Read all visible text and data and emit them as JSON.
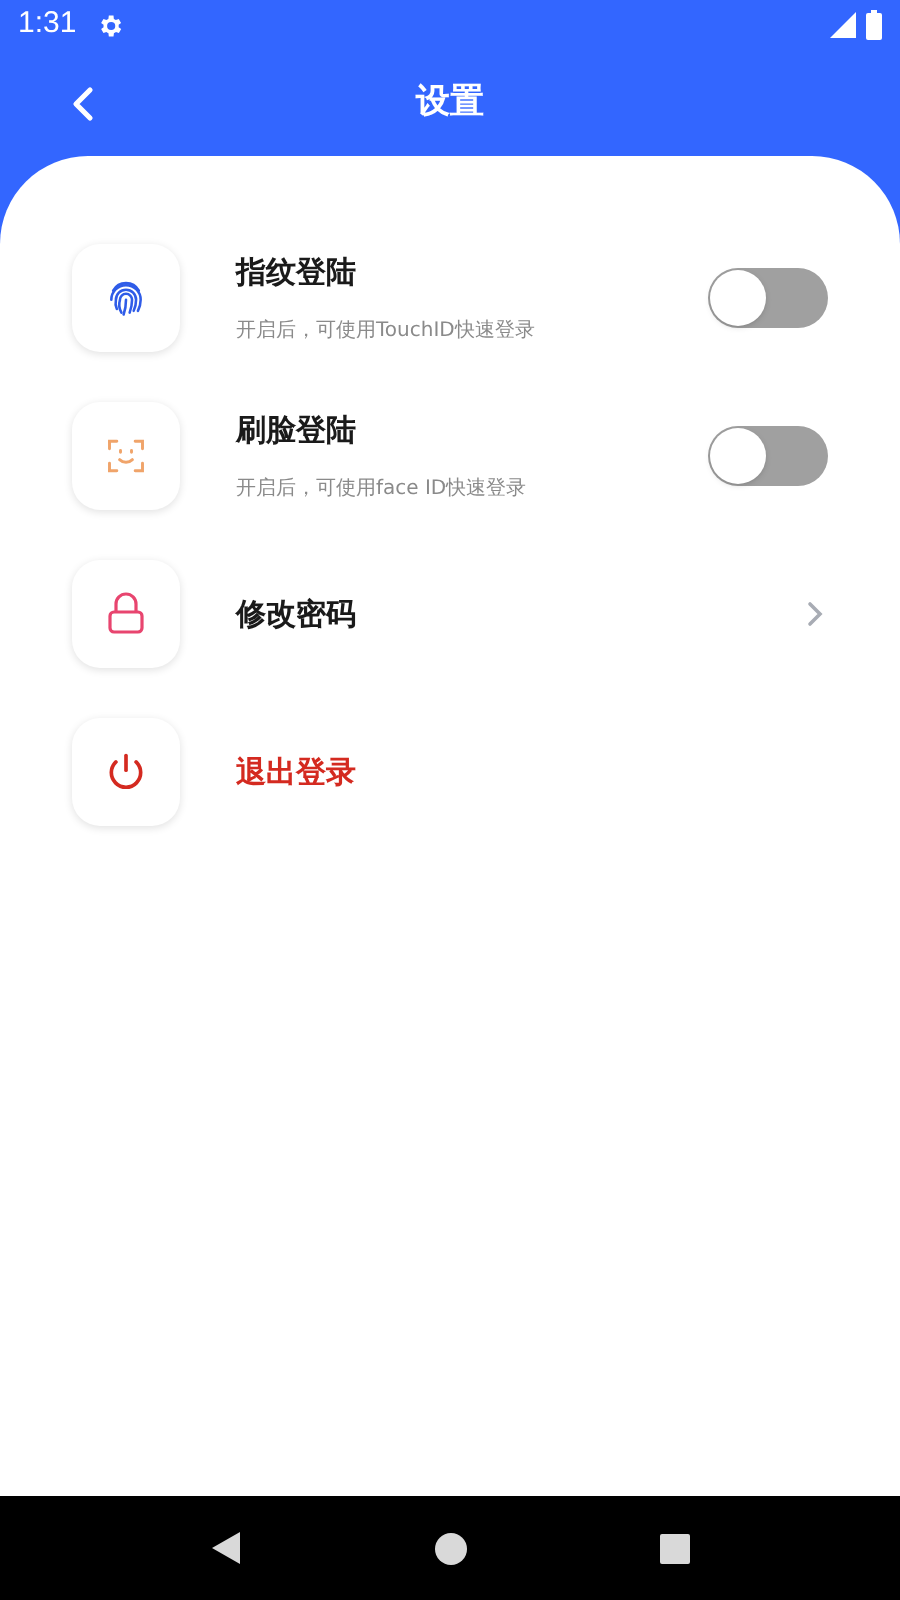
{
  "status_bar": {
    "time": "1:31"
  },
  "header": {
    "title": "设置"
  },
  "items": [
    {
      "kind": "toggle",
      "title": "指纹登陆",
      "subtitle": "开启后，可使用TouchID快速登录",
      "on": false
    },
    {
      "kind": "toggle",
      "title": "刷脸登陆",
      "subtitle": "开启后，可使用face ID快速登录",
      "on": false
    },
    {
      "kind": "link",
      "title": "修改密码"
    },
    {
      "kind": "danger",
      "title": "退出登录"
    }
  ]
}
